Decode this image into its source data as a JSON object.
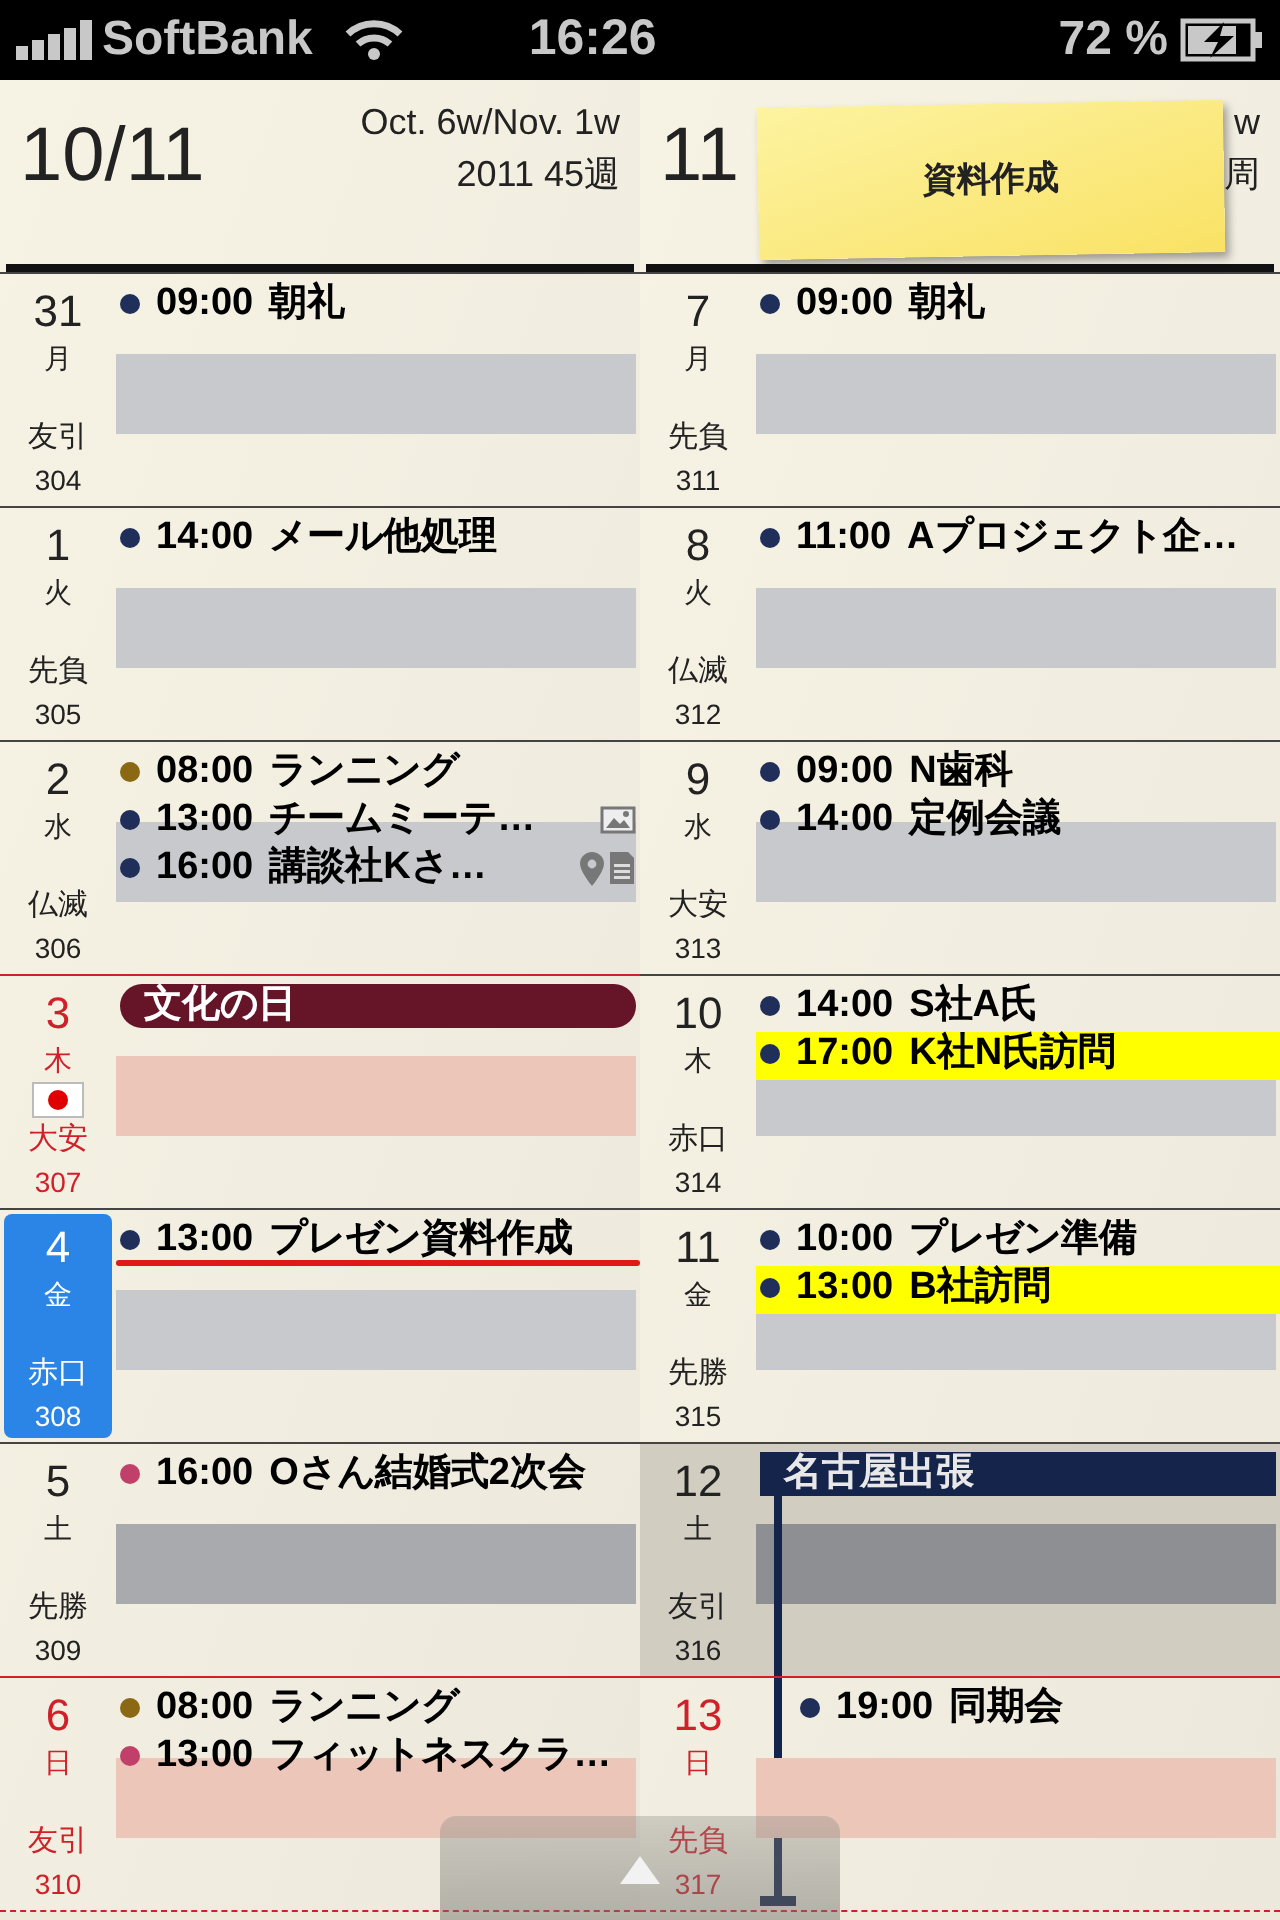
{
  "status_bar": {
    "carrier": "SoftBank",
    "time": "16:26",
    "battery": "72 %"
  },
  "columns": [
    {
      "header": {
        "date": "10/11",
        "week_label": "Oct. 6w/Nov. 1w",
        "week_number": "2011 45週"
      },
      "days": [
        {
          "day": "31",
          "weekday": "月",
          "rokuyo": "友引",
          "day_of_year": "304",
          "kind": "weekday",
          "selected": false,
          "flag": false,
          "shaded": false,
          "events": [
            {
              "time": "09:00",
              "title": "朝礼",
              "color": "#1f2f5a",
              "highlighted": false,
              "underlined": false
            }
          ]
        },
        {
          "day": "1",
          "weekday": "火",
          "rokuyo": "先負",
          "day_of_year": "305",
          "kind": "weekday",
          "selected": false,
          "flag": false,
          "shaded": false,
          "events": [
            {
              "time": "14:00",
              "title": "メール他処理",
              "color": "#1f2f5a",
              "highlighted": false,
              "underlined": false
            }
          ]
        },
        {
          "day": "2",
          "weekday": "水",
          "rokuyo": "仏滅",
          "day_of_year": "306",
          "kind": "weekday",
          "selected": false,
          "flag": false,
          "shaded": false,
          "events": [
            {
              "time": "08:00",
              "title": "ランニング",
              "color": "#8b6914",
              "highlighted": false,
              "underlined": false
            },
            {
              "time": "13:00",
              "title": "チームミーテ…",
              "color": "#1f2f5a",
              "highlighted": false,
              "underlined": false,
              "attachments": [
                {
                  "kind": "photo"
                }
              ]
            },
            {
              "time": "16:00",
              "title": "講談社Kさ…",
              "color": "#1f2f5a",
              "highlighted": false,
              "underlined": false,
              "attachments": [
                {
                  "kind": "location"
                },
                {
                  "kind": "note"
                }
              ]
            }
          ]
        },
        {
          "day": "3",
          "weekday": "木",
          "rokuyo": "大安",
          "day_of_year": "307",
          "kind": "holiday",
          "selected": false,
          "flag": true,
          "shaded": false,
          "banner": {
            "text": "文化の日",
            "kind": "holiday"
          }
        },
        {
          "day": "4",
          "weekday": "金",
          "rokuyo": "赤口",
          "day_of_year": "308",
          "kind": "weekday",
          "selected": true,
          "flag": false,
          "shaded": false,
          "events": [
            {
              "time": "13:00",
              "title": "プレゼン資料作成",
              "color": "#1f2f5a",
              "highlighted": false,
              "underlined": true
            }
          ]
        },
        {
          "day": "5",
          "weekday": "土",
          "rokuyo": "先勝",
          "day_of_year": "309",
          "kind": "saturday",
          "selected": false,
          "flag": false,
          "shaded": false,
          "events": [
            {
              "time": "16:00",
              "title": "Oさん結婚式2次会",
              "color": "#c0406a",
              "highlighted": false,
              "underlined": false
            }
          ]
        },
        {
          "day": "6",
          "weekday": "日",
          "rokuyo": "友引",
          "day_of_year": "310",
          "kind": "holiday",
          "selected": false,
          "flag": false,
          "shaded": false,
          "events": [
            {
              "time": "08:00",
              "title": "ランニング",
              "color": "#8b6914",
              "highlighted": false,
              "underlined": false
            },
            {
              "time": "13:00",
              "title": "フィットネスクラ…",
              "color": "#c0406a",
              "highlighted": false,
              "underlined": false
            }
          ]
        }
      ]
    },
    {
      "header": {
        "date": "11",
        "week_label": "w",
        "week_number": "周"
      },
      "note": {
        "text": "資料作成"
      },
      "days": [
        {
          "day": "7",
          "weekday": "月",
          "rokuyo": "先負",
          "day_of_year": "311",
          "kind": "weekday",
          "selected": false,
          "flag": false,
          "shaded": false,
          "events": [
            {
              "time": "09:00",
              "title": "朝礼",
              "color": "#1f2f5a",
              "highlighted": false,
              "underlined": false
            }
          ]
        },
        {
          "day": "8",
          "weekday": "火",
          "rokuyo": "仏滅",
          "day_of_year": "312",
          "kind": "weekday",
          "selected": false,
          "flag": false,
          "shaded": false,
          "events": [
            {
              "time": "11:00",
              "title": "Aプロジェクト企…",
              "color": "#1f2f5a",
              "highlighted": false,
              "underlined": false
            }
          ]
        },
        {
          "day": "9",
          "weekday": "水",
          "rokuyo": "大安",
          "day_of_year": "313",
          "kind": "weekday",
          "selected": false,
          "flag": false,
          "shaded": false,
          "events": [
            {
              "time": "09:00",
              "title": "N歯科",
              "color": "#1f2f5a",
              "highlighted": false,
              "underlined": false
            },
            {
              "time": "14:00",
              "title": "定例会議",
              "color": "#1f2f5a",
              "highlighted": false,
              "underlined": false
            }
          ]
        },
        {
          "day": "10",
          "weekday": "木",
          "rokuyo": "赤口",
          "day_of_year": "314",
          "kind": "weekday",
          "selected": false,
          "flag": false,
          "shaded": false,
          "events": [
            {
              "time": "14:00",
              "title": "S社A氏",
              "color": "#1f2f5a",
              "highlighted": false,
              "underlined": false
            },
            {
              "time": "17:00",
              "title": "K社N氏訪問",
              "color": "#1f2f5a",
              "highlighted": true,
              "underlined": false
            }
          ]
        },
        {
          "day": "11",
          "weekday": "金",
          "rokuyo": "先勝",
          "day_of_year": "315",
          "kind": "weekday",
          "selected": false,
          "flag": false,
          "shaded": false,
          "events": [
            {
              "time": "10:00",
              "title": "プレゼン準備",
              "color": "#1f2f5a",
              "highlighted": false,
              "underlined": false
            },
            {
              "time": "13:00",
              "title": "B社訪問",
              "color": "#1f2f5a",
              "highlighted": true,
              "underlined": false
            }
          ]
        },
        {
          "day": "12",
          "weekday": "土",
          "rokuyo": "友引",
          "day_of_year": "316",
          "kind": "saturday",
          "selected": false,
          "flag": false,
          "shaded": true,
          "banner": {
            "text": "名古屋出張",
            "kind": "trip"
          }
        },
        {
          "day": "13",
          "weekday": "日",
          "rokuyo": "先負",
          "day_of_year": "317",
          "kind": "holiday",
          "selected": false,
          "flag": false,
          "shaded": false,
          "events": [
            {
              "time": "19:00",
              "title": "同期会",
              "color": "#1f2f5a",
              "highlighted": false,
              "underlined": false
            }
          ]
        }
      ]
    }
  ]
}
